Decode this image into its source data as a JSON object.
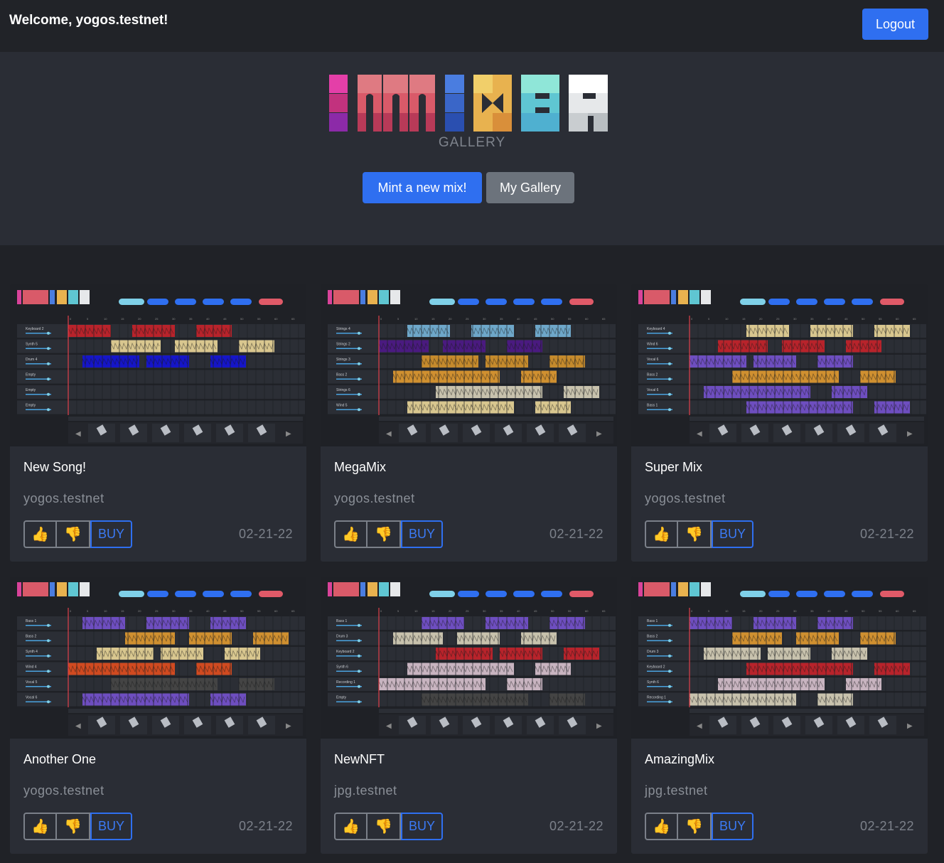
{
  "header": {
    "welcome": "Welcome, yogos.testnet!",
    "logout_label": "Logout"
  },
  "hero": {
    "logo_text": "IOMIXBR",
    "subtitle": "GALLERY",
    "mint_label": "Mint a new mix!",
    "gallery_label": "My Gallery"
  },
  "icons": {
    "like": "thumbs-up-icon",
    "dislike": "thumbs-down-icon"
  },
  "colors": {
    "accent": "#2f6ff0",
    "background": "#202227",
    "panel": "#2a2d35"
  },
  "cards": [
    {
      "title": "New Song!",
      "owner": "yogos.testnet",
      "date": "02-21-22",
      "buy_label": "BUY",
      "like": "👍",
      "dislike": "👎",
      "tracks": [
        "Keyboard 2",
        "Synth 5",
        "Drum 4",
        "Empty",
        "Empty",
        "Empty"
      ],
      "segments": [
        [
          "#b8232b",
          0,
          0.05
        ],
        [
          "#b8232b",
          0.1,
          0.15
        ],
        [
          "#b8232b",
          0.2,
          0.35
        ],
        [
          "#d9c78f",
          0.05,
          0.1
        ],
        [
          "#d9c78f",
          0.15,
          0.2
        ],
        [
          "#d9c78f",
          0.25,
          0.3
        ],
        [
          "#1515c8",
          0,
          0.05
        ],
        [
          "#1515c8",
          0.1,
          0.2
        ],
        [
          "#1515c8",
          0.25,
          0.3
        ]
      ]
    },
    {
      "title": "MegaMix",
      "owner": "yogos.testnet",
      "date": "02-21-22",
      "buy_label": "BUY",
      "like": "👍",
      "dislike": "👎",
      "tracks": [
        "Strings 4",
        "Strings 2",
        "Strings 3",
        "Bass 2",
        "Strings 6",
        "Wind 5"
      ],
      "segments": []
    },
    {
      "title": "Super Mix",
      "owner": "yogos.testnet",
      "date": "02-21-22",
      "buy_label": "BUY",
      "like": "👍",
      "dislike": "👎",
      "tracks": [
        "Keyboard 4",
        "Wind 6",
        "Vocal 6",
        "Bass 2",
        "Vocal 6",
        "Bass 1"
      ],
      "segments": []
    },
    {
      "title": "Another One",
      "owner": "yogos.testnet",
      "date": "02-21-22",
      "buy_label": "BUY",
      "like": "👍",
      "dislike": "👎",
      "tracks": [
        "Bass 1",
        "Bass 2",
        "Synth 4",
        "Wind 4",
        "Vocal 5",
        "Vocal 6"
      ],
      "segments": []
    },
    {
      "title": "NewNFT",
      "owner": "jpg.testnet",
      "date": "02-21-22",
      "buy_label": "BUY",
      "like": "👍",
      "dislike": "👎",
      "tracks": [
        "Bass 1",
        "Drum 3",
        "Keyboard 2",
        "Synth 6",
        "Recording 1",
        "Empty"
      ],
      "segments": []
    },
    {
      "title": "AmazingMix",
      "owner": "jpg.testnet",
      "date": "02-21-22",
      "buy_label": "BUY",
      "like": "👍",
      "dislike": "👎",
      "tracks": [
        "Bass 1",
        "Bass 2",
        "Drum 3",
        "Keyboard 2",
        "Synth 6",
        "Recording 1"
      ],
      "segments": []
    }
  ]
}
